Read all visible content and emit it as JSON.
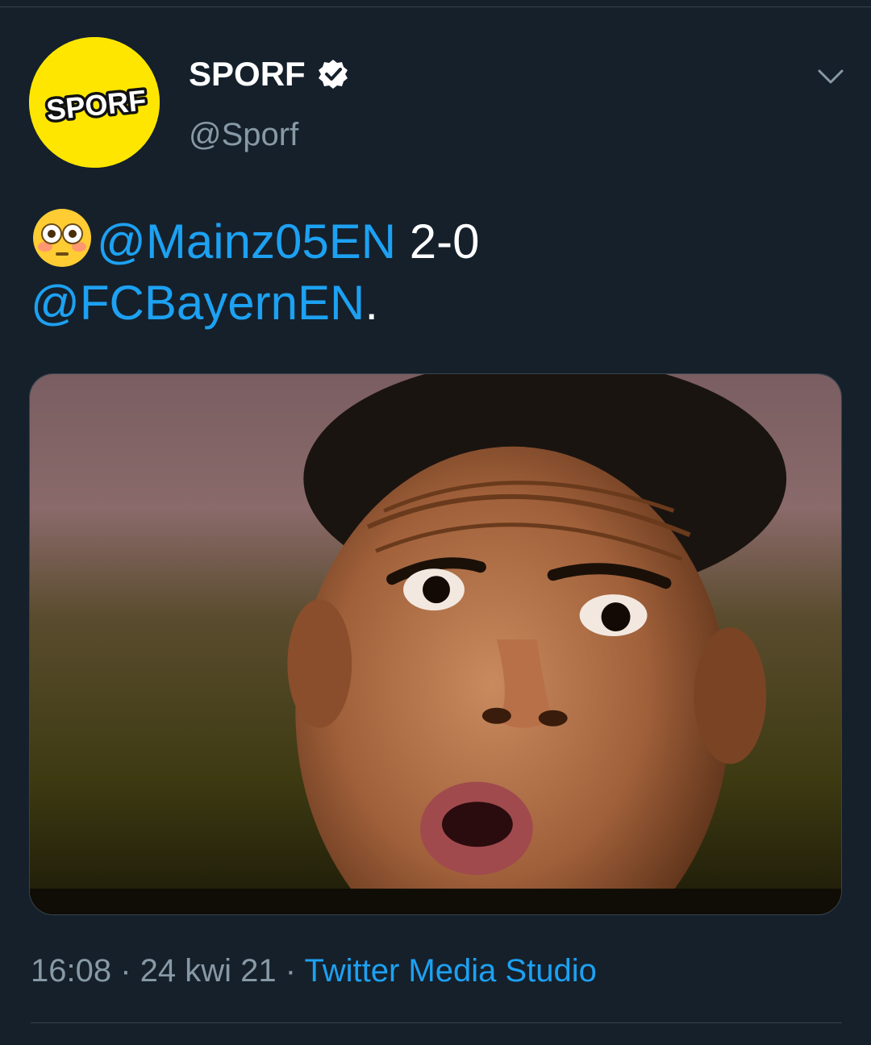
{
  "tweet": {
    "author": {
      "display_name": "SPORF",
      "handle": "@Sporf",
      "avatar_text": "SPORF",
      "verified": true
    },
    "text": {
      "emoji": "flushed-face",
      "mention_1": "@Mainz05EN",
      "score": " 2-0",
      "mention_2": "@FCBayernEN",
      "trailing": "."
    },
    "media": {
      "type": "photo",
      "icon": "photo-of-surprised-face"
    },
    "meta": {
      "time": "16:08",
      "separator_1": " · ",
      "date": "24 kwi 21",
      "separator_2": " · ",
      "source": "Twitter Media Studio"
    }
  },
  "colors": {
    "background": "#15202b",
    "accent": "#1da1f2",
    "muted": "#8899a6",
    "avatar_bg": "#ffe600"
  }
}
